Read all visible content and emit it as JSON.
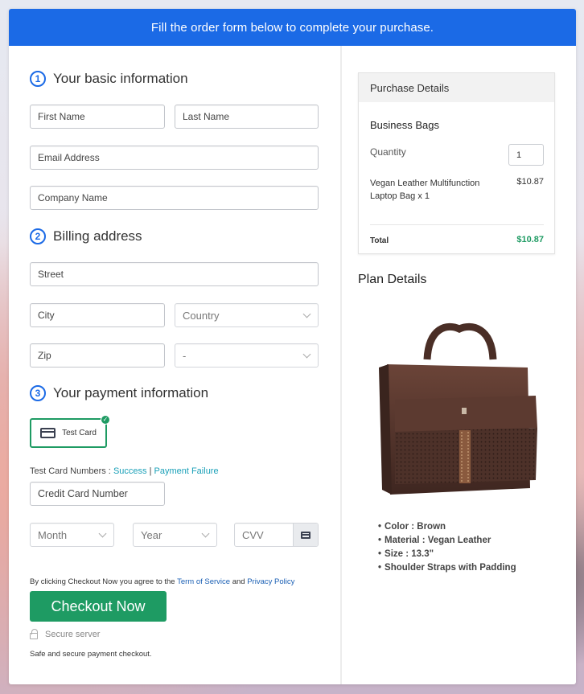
{
  "banner": {
    "text": "Fill the order form below to complete your purchase."
  },
  "sections": {
    "basic": {
      "number": "1",
      "title": "Your basic information"
    },
    "billing": {
      "number": "2",
      "title": "Billing address"
    },
    "payment": {
      "number": "3",
      "title": "Your payment information"
    }
  },
  "fields": {
    "first_name": "First Name",
    "last_name": "Last Name",
    "email": "Email Address",
    "company": "Company Name",
    "street": "Street",
    "city": "City",
    "country": "Country",
    "state": "-",
    "zip": "Zip",
    "card_number": "Credit Card Number",
    "month": "Month",
    "year": "Year",
    "cvv": "CVV"
  },
  "payment": {
    "method_label": "Test Card",
    "test_numbers_label": "Test Card Numbers :",
    "success_link": "Success",
    "separator": "|",
    "failure_link": "Payment Failure"
  },
  "agreement": {
    "prefix": "By clicking Checkout Now you agree to the",
    "terms_link": "Term of Service",
    "and": "and",
    "privacy_link": "Privacy Policy"
  },
  "checkout": {
    "button_label": "Checkout Now",
    "secure_label": "Secure server",
    "safe_text": "Safe and secure payment checkout."
  },
  "purchase_details": {
    "header": "Purchase Details",
    "product_group": "Business Bags",
    "quantity_label": "Quantity",
    "quantity_value": "1",
    "item_name": "Vegan Leather Multifunction Laptop Bag x 1",
    "item_price": "$10.87",
    "total_label": "Total",
    "total_value": "$10.87"
  },
  "plan_details": {
    "title": "Plan Details",
    "features": [
      "Color : Brown",
      "Material : Vegan Leather",
      "Size : 13.3\"",
      "Shoulder Straps with Padding"
    ]
  },
  "colors": {
    "brand_blue": "#1b6ae6",
    "success_green": "#1e9b63"
  }
}
